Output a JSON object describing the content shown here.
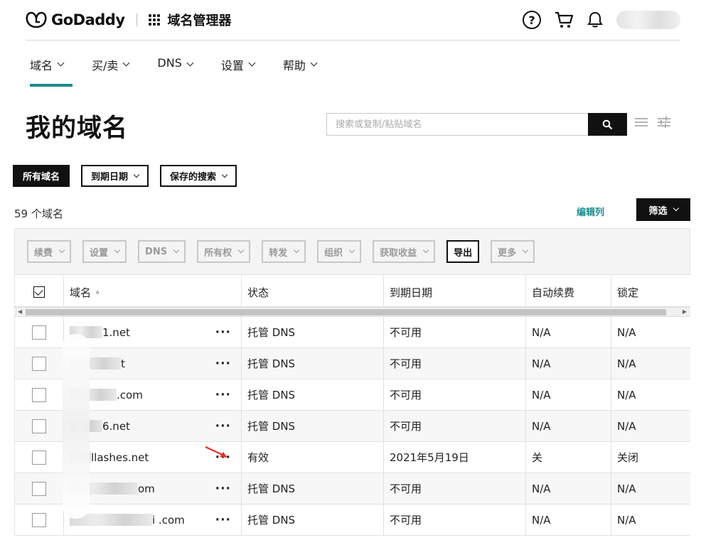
{
  "header": {
    "brand": "GoDaddy",
    "product_title": "域名管理器"
  },
  "nav": [
    {
      "label": "域名"
    },
    {
      "label": "买/卖"
    },
    {
      "label": "DNS"
    },
    {
      "label": "设置"
    },
    {
      "label": "帮助"
    }
  ],
  "page": {
    "title": "我的域名",
    "search_placeholder": "搜索或复制/粘贴域名",
    "count": "59 个域名",
    "edit_columns": "编辑列",
    "filter": "筛选"
  },
  "tabs": [
    {
      "label": "所有域名"
    },
    {
      "label": "到期日期"
    },
    {
      "label": "保存的搜索"
    }
  ],
  "actions": [
    {
      "label": "续费"
    },
    {
      "label": "设置"
    },
    {
      "label": "DNS"
    },
    {
      "label": "所有权"
    },
    {
      "label": "转发"
    },
    {
      "label": "组织"
    },
    {
      "label": "获取收益"
    },
    {
      "label": "导出"
    },
    {
      "label": "更多"
    }
  ],
  "table": {
    "headers": [
      "域名",
      "状态",
      "到期日期",
      "自动续费",
      "锁定"
    ],
    "rows": [
      {
        "domain": "1.net",
        "status": "托管 DNS",
        "expiry": "不可用",
        "auto_renew": "N/A",
        "lock": "N/A"
      },
      {
        "domain": "t",
        "status": "托管 DNS",
        "expiry": "不可用",
        "auto_renew": "N/A",
        "lock": "N/A"
      },
      {
        "domain": ".com",
        "status": "托管 DNS",
        "expiry": "不可用",
        "auto_renew": "N/A",
        "lock": "N/A"
      },
      {
        "domain": "6.net",
        "status": "托管 DNS",
        "expiry": "不可用",
        "auto_renew": "N/A",
        "lock": "N/A"
      },
      {
        "domain": "llashes.net",
        "status": "有效",
        "expiry": "2021年5月19日",
        "auto_renew": "关",
        "lock": "关闭"
      },
      {
        "domain": "om",
        "status": "托管 DNS",
        "expiry": "不可用",
        "auto_renew": "N/A",
        "lock": "N/A"
      },
      {
        "domain": "i .com",
        "status": "托管 DNS",
        "expiry": "不可用",
        "auto_renew": "N/A",
        "lock": "N/A"
      }
    ],
    "more_label": "···"
  },
  "colors": {
    "accent": "#1b8b8c",
    "dark": "#111111",
    "annotation": "#e8302a"
  }
}
